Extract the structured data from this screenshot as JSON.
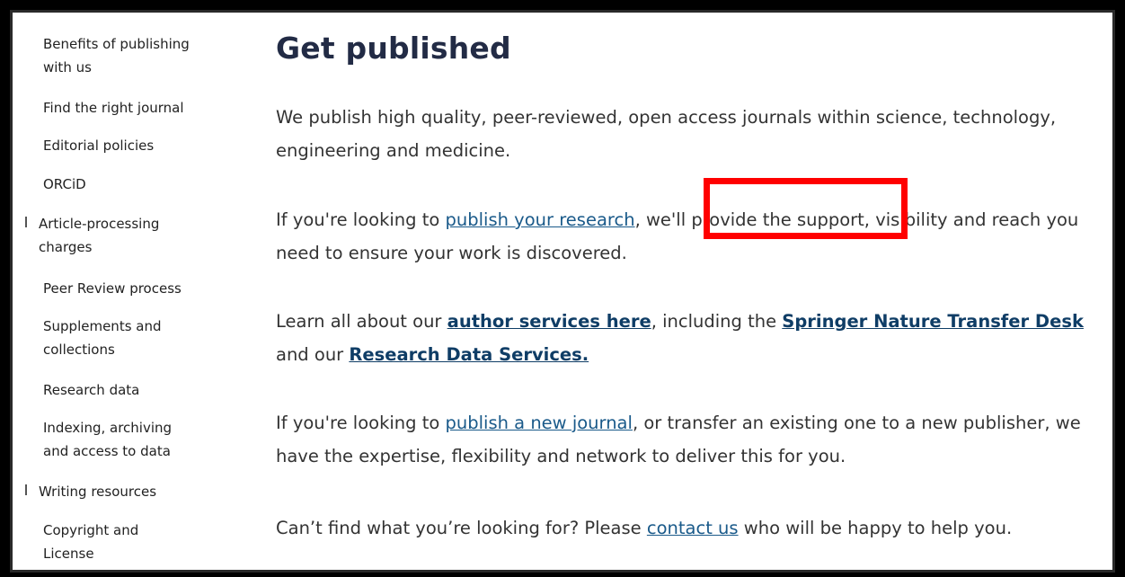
{
  "sidebar": {
    "items": [
      {
        "label": "Benefits of publishing with us"
      },
      {
        "label": "Find the right journal"
      },
      {
        "label": "Editorial policies"
      },
      {
        "label": "ORCiD"
      },
      {
        "label": "Article-processing charges"
      },
      {
        "label": "Peer Review process"
      },
      {
        "label": "Supplements and collections"
      },
      {
        "label": "Research data"
      },
      {
        "label": "Indexing, archiving and access to data"
      },
      {
        "label": "Writing resources"
      },
      {
        "label": "Copyright and License"
      }
    ]
  },
  "main": {
    "title": "Get published",
    "p1": "We publish high quality, peer-reviewed, open access journals within science, technology, engineering and medicine.",
    "p2": {
      "before": "If you're looking to ",
      "link": "publish your research",
      "after": ", we'll provide the support, visibility and reach you need to ensure your work is discovered."
    },
    "p3": {
      "before": "Learn all about our ",
      "link1": "author services here",
      "middle": ", including the ",
      "link2": "Springer Nature Transfer Desk",
      "middle2": " and our ",
      "link3": "Research Data Services."
    },
    "p4": {
      "before": "If you're looking to ",
      "link": "publish a new journal",
      "after": ", or transfer an existing one to a new publisher, we have the expertise, flexibility and network to deliver this for you."
    },
    "p5": {
      "before": "Can’t find what you’re looking for? Please ",
      "link": "contact us",
      "after": " who will be happy to help you."
    }
  },
  "colors": {
    "highlight": "#ff0000",
    "link": "#1a5a8a",
    "title": "#222b45"
  }
}
